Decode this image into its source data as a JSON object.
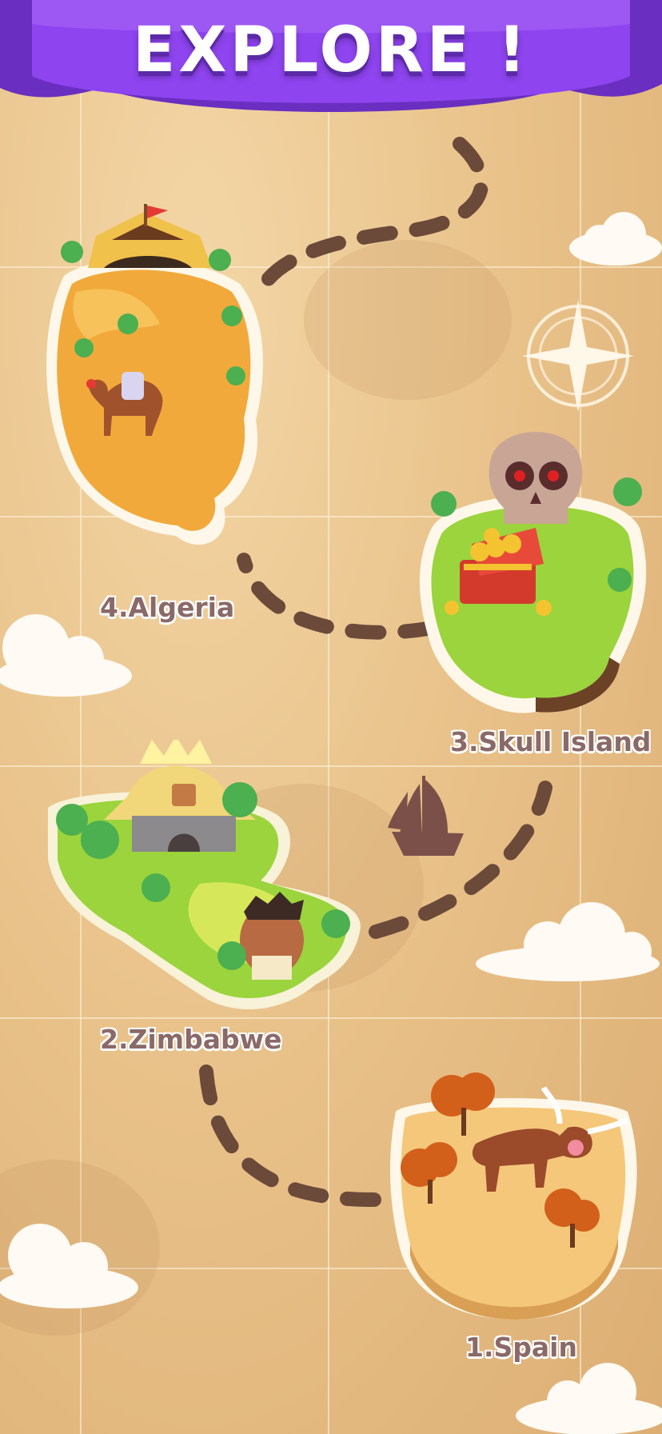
{
  "banner": {
    "title": "EXPLORE !"
  },
  "locations": [
    {
      "id": "spain",
      "label": "1.Spain"
    },
    {
      "id": "zimbabwe",
      "label": "2.Zimbabwe"
    },
    {
      "id": "skull-island",
      "label": "3.Skull Island"
    },
    {
      "id": "algeria",
      "label": "4.Algeria"
    }
  ],
  "colors": {
    "banner_purple": "#8e44ef",
    "banner_dark": "#6a2fc0",
    "path_brown": "#6b4a3a",
    "label_text": "#8a6a69",
    "desert": "#f2a93b",
    "grass": "#9bd43c",
    "spain_sand": "#f5c77a"
  },
  "icons": [
    "compass-rose-icon",
    "pirate-ship-icon",
    "red-flag-icon"
  ]
}
